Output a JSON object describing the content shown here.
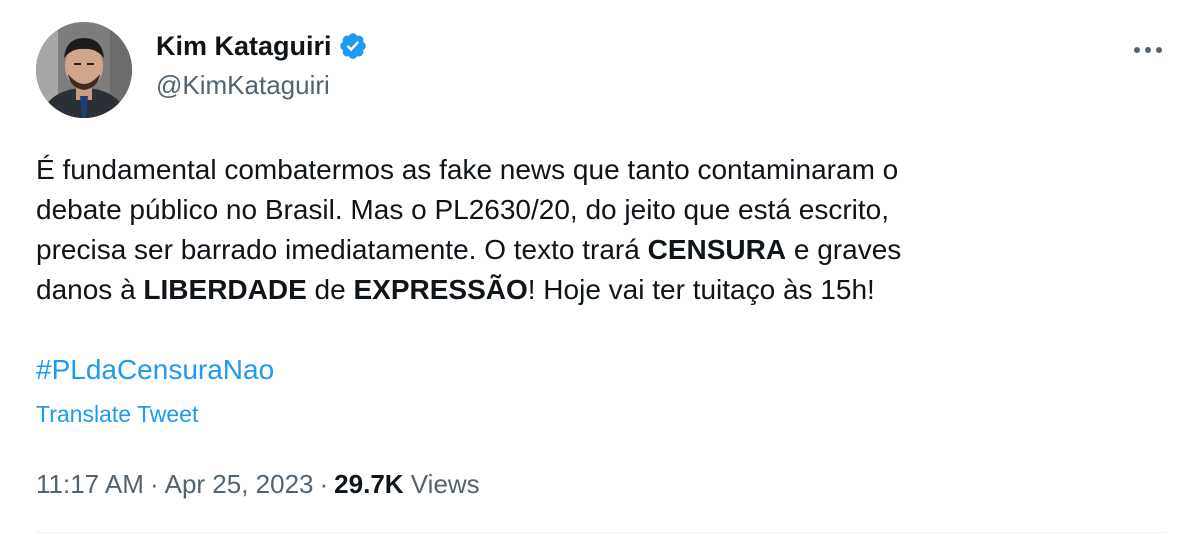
{
  "author": {
    "display_name": "Kim Kataguiri",
    "handle": "@KimKataguiri",
    "verified_color": "#1d9bf0"
  },
  "tweet": {
    "lines": [
      [
        {
          "text": "É fundamental combatermos as fake news que tanto contaminaram o",
          "bold": false
        }
      ],
      [
        {
          "text": "debate público no Brasil. Mas o PL2630/20, do jeito que está escrito,",
          "bold": false
        }
      ],
      [
        {
          "text": "precisa ser barrado imediatamente. O texto trará ",
          "bold": false
        },
        {
          "text": "CENSURA",
          "bold": true
        },
        {
          "text": " e graves",
          "bold": false
        }
      ],
      [
        {
          "text": "danos à ",
          "bold": false
        },
        {
          "text": "LIBERDADE",
          "bold": true
        },
        {
          "text": " de ",
          "bold": false
        },
        {
          "text": "EXPRESSÃO",
          "bold": true
        },
        {
          "text": "! Hoje vai ter tuitaço às 15h!",
          "bold": false
        }
      ]
    ],
    "hashtag": "#PLdaCensuraNao",
    "translate_label": "Translate Tweet"
  },
  "meta": {
    "time": "11:17 AM",
    "separator": "·",
    "date": "Apr 25, 2023",
    "views_count": "29.7K",
    "views_label": "Views"
  },
  "icons": {
    "more": "more-horizontal-icon",
    "verified": "verified-badge-icon"
  },
  "colors": {
    "text": "#0f1419",
    "secondary": "#536471",
    "link": "#1d9bf0",
    "divider": "#eff3f4"
  }
}
